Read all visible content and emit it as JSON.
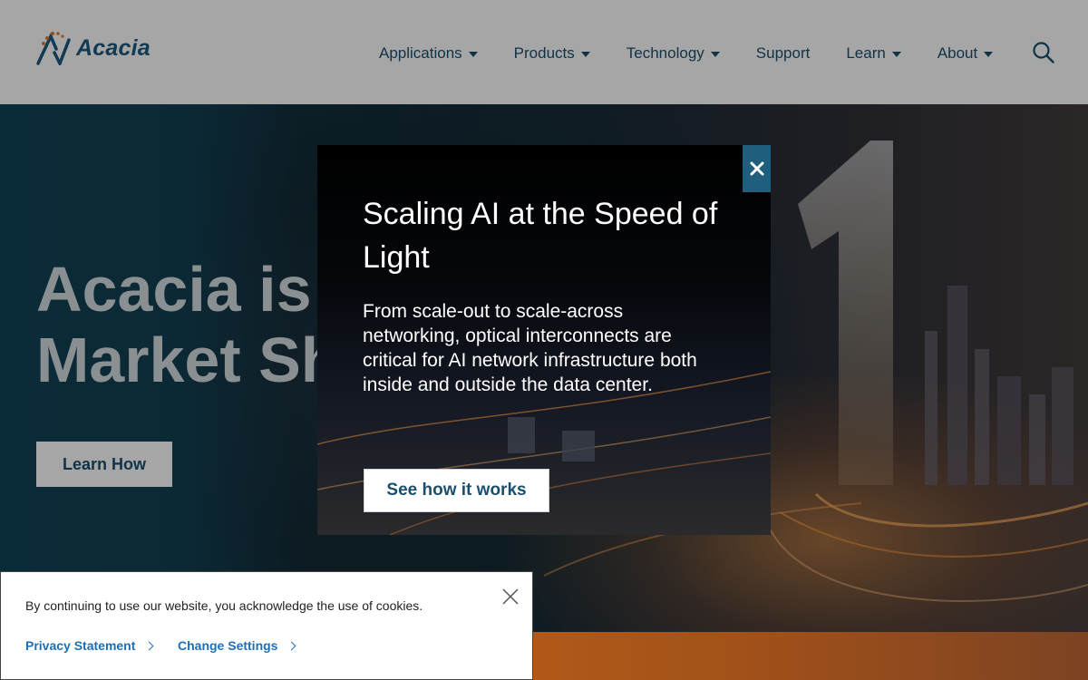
{
  "brand": {
    "name": "Acacia",
    "logo_color": "#1c5a80",
    "accent": "#e07b2a"
  },
  "nav": {
    "items": [
      {
        "label": "Applications",
        "has_dropdown": true
      },
      {
        "label": "Products",
        "has_dropdown": true
      },
      {
        "label": "Technology",
        "has_dropdown": true
      },
      {
        "label": "Support",
        "has_dropdown": false
      },
      {
        "label": "Learn",
        "has_dropdown": true
      },
      {
        "label": "About",
        "has_dropdown": true
      }
    ],
    "search_icon": "search-icon"
  },
  "hero": {
    "title_line1": "Acacia is",
    "title_line2": "Market Sh",
    "button_label": "Learn How"
  },
  "modal": {
    "title": "Scaling AI at the Speed of Light",
    "body": "From scale-out to scale-across networking, optical interconnects are critical for AI network infrastructure both inside and outside the data center.",
    "button_label": "See how it works",
    "close_label": "×",
    "close_bg": "#1f5e7d"
  },
  "cookie": {
    "message": "By continuing to use our website, you acknowledge the use of cookies.",
    "privacy_label": "Privacy Statement",
    "settings_label": "Change Settings",
    "link_color": "#1f6fb5",
    "close_icon": "close-icon"
  }
}
